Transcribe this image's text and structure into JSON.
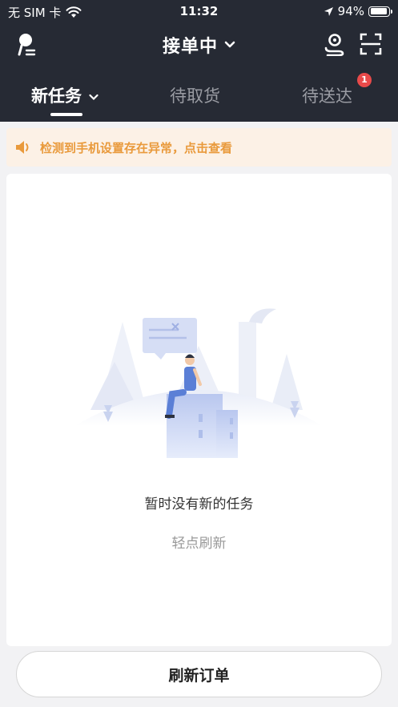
{
  "status_bar": {
    "carrier": "无 SIM 卡",
    "time": "11:32",
    "battery": "94%",
    "battery_level": 0.94
  },
  "topbar": {
    "title": "接单中",
    "icons": [
      "user-icon",
      "location-pin-icon",
      "scan-icon"
    ]
  },
  "tabs": [
    {
      "label": "新任务",
      "active": true
    },
    {
      "label": "待取货",
      "active": false
    },
    {
      "label": "待送达",
      "active": false,
      "badge": "1"
    }
  ],
  "notice": {
    "text": "检测到手机设置存在异常，点击查看",
    "color": "#e99a3c"
  },
  "empty_state": {
    "title": "暂时没有新的任务",
    "subtitle": "轻点刷新"
  },
  "bottom": {
    "button_label": "刷新订单"
  },
  "colors": {
    "header_bg": "#262a34",
    "badge": "#e84a4a"
  }
}
